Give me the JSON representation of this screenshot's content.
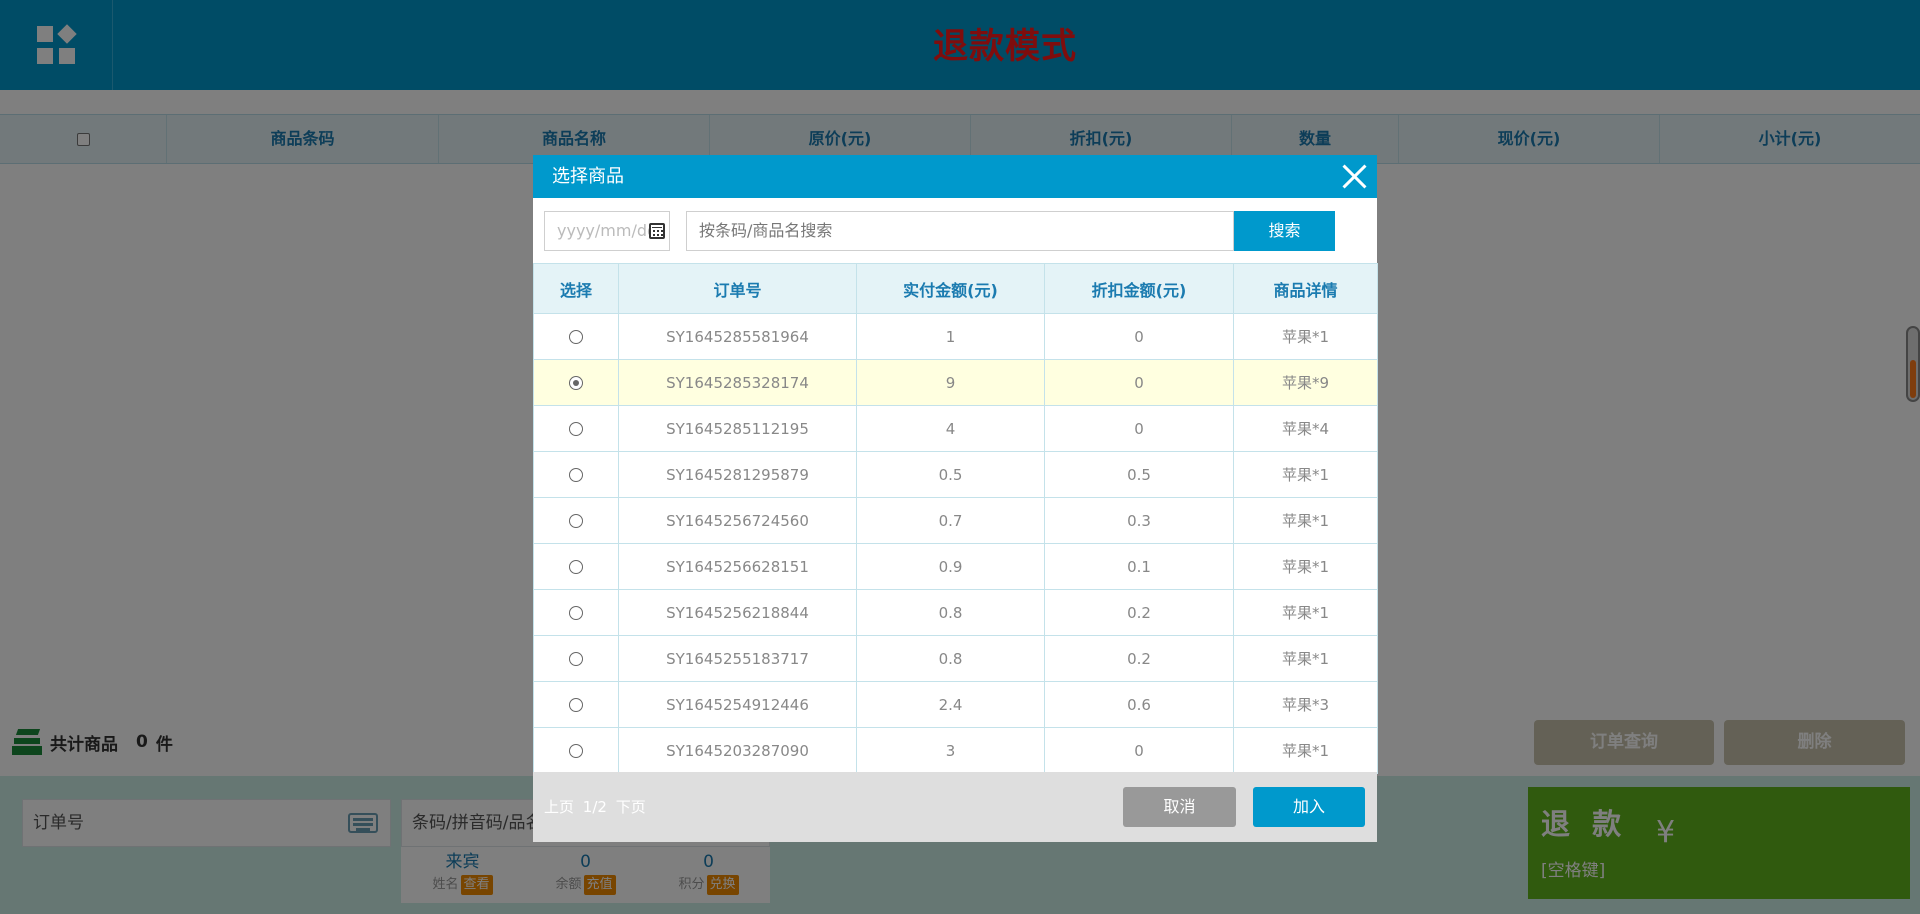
{
  "app": {
    "title": "退款模式",
    "menu_icon": "grid-menu-icon",
    "colors": {
      "header": "#0099cc",
      "title": "#ff1a1a",
      "refund_panel": "#61b51d",
      "action_button": "#c9c3ad"
    }
  },
  "grid": {
    "columns": [
      "商品条码",
      "商品名称",
      "原价(元)",
      "折扣(元)",
      "数量",
      "现价(元)",
      "小计(元)"
    ]
  },
  "summary": {
    "label": "共计商品",
    "count": "0",
    "unit": "件"
  },
  "actions": {
    "order_query": "订单查询",
    "delete": "删除"
  },
  "bottom": {
    "order_placeholder": "订单号",
    "barcode_placeholder": "条码/拼音码/品名",
    "member": [
      {
        "value": "来宾",
        "label": "姓名",
        "tag": "查看"
      },
      {
        "value": "0",
        "label": "余额",
        "tag": "充值"
      },
      {
        "value": "0",
        "label": "积分",
        "tag": "兑换"
      }
    ]
  },
  "refund": {
    "title": "退 款",
    "currency": "¥",
    "hint": "[空格键]"
  },
  "modal": {
    "title": "选择商品",
    "date_placeholder": "yyyy/mm/dd",
    "search_placeholder": "按条码/商品名搜索",
    "search_button": "搜索",
    "columns": [
      "选择",
      "订单号",
      "实付金额(元)",
      "折扣金额(元)",
      "商品详情"
    ],
    "rows": [
      {
        "order": "SY1645285581964",
        "paid": "1",
        "discount": "0",
        "detail": "苹果*1",
        "selected": false
      },
      {
        "order": "SY1645285328174",
        "paid": "9",
        "discount": "0",
        "detail": "苹果*9",
        "selected": true
      },
      {
        "order": "SY1645285112195",
        "paid": "4",
        "discount": "0",
        "detail": "苹果*4",
        "selected": false
      },
      {
        "order": "SY1645281295879",
        "paid": "0.5",
        "discount": "0.5",
        "detail": "苹果*1",
        "selected": false
      },
      {
        "order": "SY1645256724560",
        "paid": "0.7",
        "discount": "0.3",
        "detail": "苹果*1",
        "selected": false
      },
      {
        "order": "SY1645256628151",
        "paid": "0.9",
        "discount": "0.1",
        "detail": "苹果*1",
        "selected": false
      },
      {
        "order": "SY1645256218844",
        "paid": "0.8",
        "discount": "0.2",
        "detail": "苹果*1",
        "selected": false
      },
      {
        "order": "SY1645255183717",
        "paid": "0.8",
        "discount": "0.2",
        "detail": "苹果*1",
        "selected": false
      },
      {
        "order": "SY1645254912446",
        "paid": "2.4",
        "discount": "0.6",
        "detail": "苹果*3",
        "selected": false
      },
      {
        "order": "SY1645203287090",
        "paid": "3",
        "discount": "0",
        "detail": "苹果*1",
        "selected": false
      }
    ],
    "pager": {
      "prev": "上页",
      "page": "1/2",
      "next": "下页"
    },
    "cancel": "取消",
    "add": "加入"
  }
}
